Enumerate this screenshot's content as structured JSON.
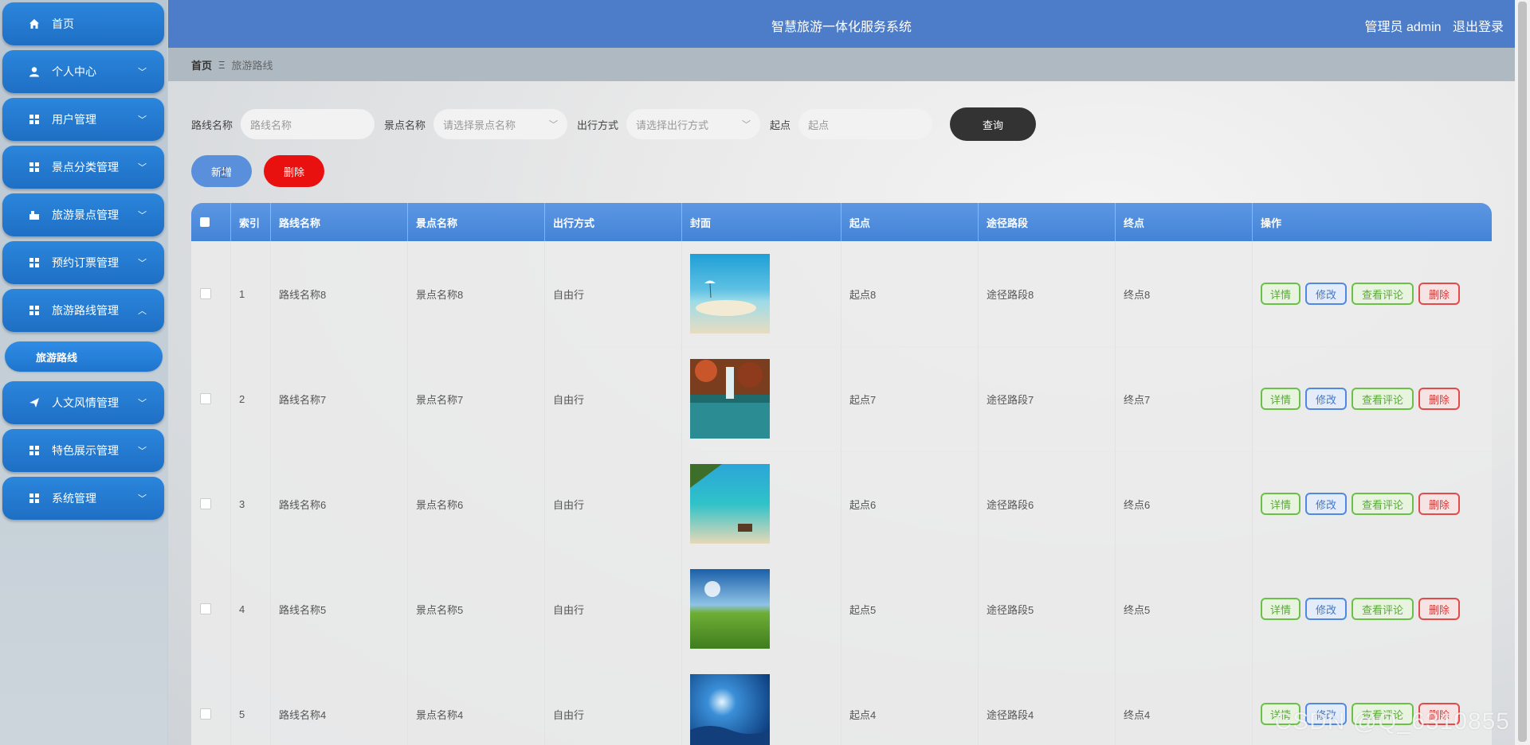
{
  "header": {
    "title": "智慧旅游一体化服务系统",
    "user": "管理员 admin",
    "logout": "退出登录"
  },
  "sidebar": {
    "items": [
      {
        "label": "首页",
        "icon": "home-icon"
      },
      {
        "label": "个人中心",
        "icon": "user-icon"
      },
      {
        "label": "用户管理",
        "icon": "grid-icon"
      },
      {
        "label": "景点分类管理",
        "icon": "grid-icon"
      },
      {
        "label": "旅游景点管理",
        "icon": "building-icon"
      },
      {
        "label": "预约订票管理",
        "icon": "grid-icon"
      },
      {
        "label": "旅游路线管理",
        "icon": "grid-icon"
      },
      {
        "label": "人文风情管理",
        "icon": "send-icon"
      },
      {
        "label": "特色展示管理",
        "icon": "grid-icon"
      },
      {
        "label": "系统管理",
        "icon": "grid-icon"
      }
    ],
    "sub_item": "旅游路线"
  },
  "breadcrumb": {
    "home": "首页",
    "separator": "Ξ",
    "current": "旅游路线"
  },
  "search": {
    "route_label": "路线名称",
    "route_placeholder": "路线名称",
    "spot_label": "景点名称",
    "spot_placeholder": "请选择景点名称",
    "travel_label": "出行方式",
    "travel_placeholder": "请选择出行方式",
    "start_label": "起点",
    "start_placeholder": "起点",
    "query": "查询"
  },
  "toolbar": {
    "add": "新增",
    "delete": "删除"
  },
  "table": {
    "headers": [
      "索引",
      "路线名称",
      "景点名称",
      "出行方式",
      "封面",
      "起点",
      "途径路段",
      "终点",
      "操作"
    ],
    "rows": [
      {
        "index": "1",
        "route": "路线名称8",
        "spot": "景点名称8",
        "mode": "自由行",
        "start": "起点8",
        "via": "途径路段8",
        "end": "终点8"
      },
      {
        "index": "2",
        "route": "路线名称7",
        "spot": "景点名称7",
        "mode": "自由行",
        "start": "起点7",
        "via": "途径路段7",
        "end": "终点7"
      },
      {
        "index": "3",
        "route": "路线名称6",
        "spot": "景点名称6",
        "mode": "自由行",
        "start": "起点6",
        "via": "途径路段6",
        "end": "终点6"
      },
      {
        "index": "4",
        "route": "路线名称5",
        "spot": "景点名称5",
        "mode": "自由行",
        "start": "起点5",
        "via": "途径路段5",
        "end": "终点5"
      },
      {
        "index": "5",
        "route": "路线名称4",
        "spot": "景点名称4",
        "mode": "自由行",
        "start": "起点4",
        "via": "途径路段4",
        "end": "终点4"
      }
    ],
    "actions": {
      "detail": "详情",
      "edit": "修改",
      "review": "查看评论",
      "delete": "删除"
    }
  },
  "watermark": "CSDN @Q_6310855",
  "colors": {
    "header": "#4d7dc8",
    "menu": "#2178d0",
    "table_header": "#4d8ddb",
    "delete": "#e8110f"
  }
}
